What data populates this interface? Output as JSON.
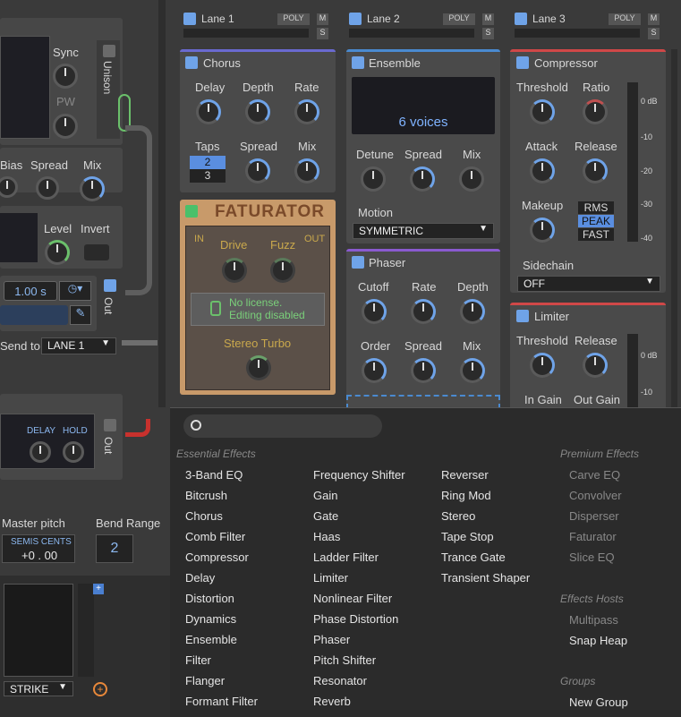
{
  "lanes": [
    {
      "name": "Lane 1",
      "poly": "POLY",
      "m": "M",
      "s": "S"
    },
    {
      "name": "Lane 2",
      "poly": "POLY",
      "m": "M",
      "s": "S"
    },
    {
      "name": "Lane 3",
      "poly": "POLY",
      "m": "M",
      "s": "S"
    }
  ],
  "left": {
    "sync": "Sync",
    "pw": "PW",
    "unison": "Unison",
    "bias": "Bias",
    "spread": "Spread",
    "mix": "Mix",
    "level": "Level",
    "invert": "Invert",
    "time_value": "1.00 s",
    "out": "Out",
    "send_to": "Send to",
    "send_target": "LANE 1",
    "delay": "DELAY",
    "hold": "HOLD",
    "out2": "Out",
    "master_pitch": "Master pitch",
    "semis_cents": "SEMIS CENTS",
    "pitch_value": "+0 . 00",
    "bend_range": "Bend Range",
    "bend_value": "2",
    "strike": "STRIKE"
  },
  "chorus": {
    "title": "Chorus",
    "delay": "Delay",
    "depth": "Depth",
    "rate": "Rate",
    "taps": "Taps",
    "taps_sel": "2",
    "taps_alt": "3",
    "spread": "Spread",
    "mix": "Mix"
  },
  "ensemble": {
    "title": "Ensemble",
    "voices": "6 voices",
    "detune": "Detune",
    "spread": "Spread",
    "mix": "Mix",
    "motion": "Motion",
    "motion_value": "SYMMETRIC"
  },
  "compressor": {
    "title": "Compressor",
    "threshold": "Threshold",
    "ratio": "Ratio",
    "attack": "Attack",
    "release": "Release",
    "makeup": "Makeup",
    "modes": [
      "RMS",
      "PEAK",
      "FAST"
    ],
    "sidechain": "Sidechain",
    "sidechain_value": "OFF",
    "scale": [
      "0 dB",
      "-10",
      "-20",
      "-30",
      "-40"
    ]
  },
  "faturator": {
    "title": "FATURATOR",
    "in": "IN",
    "out": "OUT",
    "drive": "Drive",
    "fuzz": "Fuzz",
    "license1": "No license.",
    "license2": "Editing disabled",
    "stereo_turbo": "Stereo Turbo"
  },
  "phaser": {
    "title": "Phaser",
    "cutoff": "Cutoff",
    "rate": "Rate",
    "depth": "Depth",
    "order": "Order",
    "spread": "Spread",
    "mix": "Mix"
  },
  "limiter": {
    "title": "Limiter",
    "threshold": "Threshold",
    "release": "Release",
    "in_gain": "In Gain",
    "out_gain": "Out Gain",
    "scale": [
      "0 dB",
      "-10"
    ]
  },
  "menu": {
    "search_placeholder": "",
    "essential": "Essential Effects",
    "premium": "Premium Effects",
    "hosts": "Effects Hosts",
    "groups": "Groups",
    "col1": [
      "3-Band EQ",
      "Bitcrush",
      "Chorus",
      "Comb Filter",
      "Compressor",
      "Delay",
      "Distortion",
      "Dynamics",
      "Ensemble",
      "Filter",
      "Flanger",
      "Formant Filter"
    ],
    "col2": [
      "Frequency Shifter",
      "Gain",
      "Gate",
      "Haas",
      "Ladder Filter",
      "Limiter",
      "Nonlinear Filter",
      "Phase Distortion",
      "Phaser",
      "Pitch Shifter",
      "Resonator",
      "Reverb"
    ],
    "col3": [
      "Reverser",
      "Ring Mod",
      "Stereo",
      "Tape Stop",
      "Trance Gate",
      "Transient Shaper"
    ],
    "premium_items": [
      "Carve EQ",
      "Convolver",
      "Disperser",
      "Faturator",
      "Slice EQ"
    ],
    "host_items": [
      "Multipass",
      "Snap Heap"
    ],
    "group_items": [
      "New Group"
    ]
  }
}
